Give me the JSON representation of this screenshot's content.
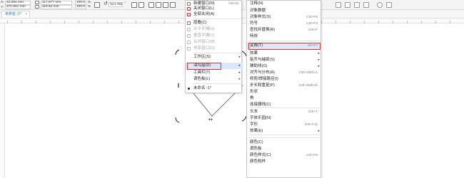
{
  "propbar": {
    "x_value": "42.081 mm",
    "y_value": "271.841 mm",
    "w_value": "117.677 mm",
    "h_value": "118.52 mm",
    "sx_value": "100.0",
    "sy_value": "100.0",
    "pct": "%",
    "angle_value": "314.782",
    "angle_unit": "°"
  },
  "tab": {
    "label": "未命名 -1*",
    "close": "×"
  },
  "main_menu": {
    "items": [
      {
        "label": "关闭窗口(L)",
        "shortcut": ""
      },
      {
        "label": "全部关闭(A)",
        "shortcut": ""
      },
      {
        "label": "层叠(C)",
        "shortcut": ""
      },
      {
        "label": "水平平铺(H)",
        "shortcut": ""
      },
      {
        "label": "垂直平铺(V)",
        "shortcut": ""
      },
      {
        "label": "合并窗口(M)",
        "shortcut": ""
      },
      {
        "label": "停靠窗口(D)",
        "shortcut": ""
      },
      {
        "label": "工作区(S)",
        "shortcut": ""
      },
      {
        "label": "泊坞窗(D)",
        "shortcut": ""
      },
      {
        "label": "工具栏(T)",
        "shortcut": ""
      },
      {
        "label": "调色板(L)",
        "shortcut": ""
      },
      {
        "label": "未命名 -1*",
        "shortcut": ""
      }
    ],
    "top_item": "新建窗口(N)",
    "top_shortcut": "Ctrl+N"
  },
  "docker_menu": {
    "items": [
      {
        "label": "注释(N)",
        "shortcut": ""
      },
      {
        "label": "对象数据",
        "shortcut": ""
      },
      {
        "label": "对象样式(S)",
        "shortcut": "Ctrl+F5"
      },
      {
        "label": "符号",
        "shortcut": "Ctrl+F3"
      },
      {
        "label": "查找并替换(R)",
        "shortcut": "Ctrl+F"
      },
      {
        "label": "特效",
        "shortcut": ""
      },
      {
        "label": "变换(T)",
        "shortcut": "Alt+F7"
      },
      {
        "label": "效果",
        "shortcut": ""
      },
      {
        "label": "贴齐与捕捉(S)",
        "shortcut": ""
      },
      {
        "label": "辅助线(G)",
        "shortcut": ""
      },
      {
        "label": "对齐与分布(A)",
        "shortcut": "Ctrl+Shift+A"
      },
      {
        "label": "修剪/焊接路径(I)",
        "shortcut": ""
      },
      {
        "label": "步长和重复(P)",
        "shortcut": "Ctrl+Shift+D"
      },
      {
        "label": "形状",
        "shortcut": ""
      },
      {
        "label": "角",
        "shortcut": ""
      },
      {
        "label": "连接器线(C)",
        "shortcut": ""
      },
      {
        "label": "文本",
        "shortcut": "Ctrl+T"
      },
      {
        "label": "字体乐园(N)",
        "shortcut": ""
      },
      {
        "label": "字形",
        "shortcut": "Ctrl+F11"
      },
      {
        "label": "效果(E)",
        "shortcut": ""
      },
      {
        "label": "颜色(C)",
        "shortcut": ""
      },
      {
        "label": "调色板",
        "shortcut": ""
      },
      {
        "label": "颜色样式(C)",
        "shortcut": "Ctrl+F6"
      },
      {
        "label": "颜色校样",
        "shortcut": ""
      }
    ]
  },
  "colors": {
    "highlight": "#dbe8fb",
    "redbox": "#e03030",
    "tab_text": "#1a6bd0"
  }
}
